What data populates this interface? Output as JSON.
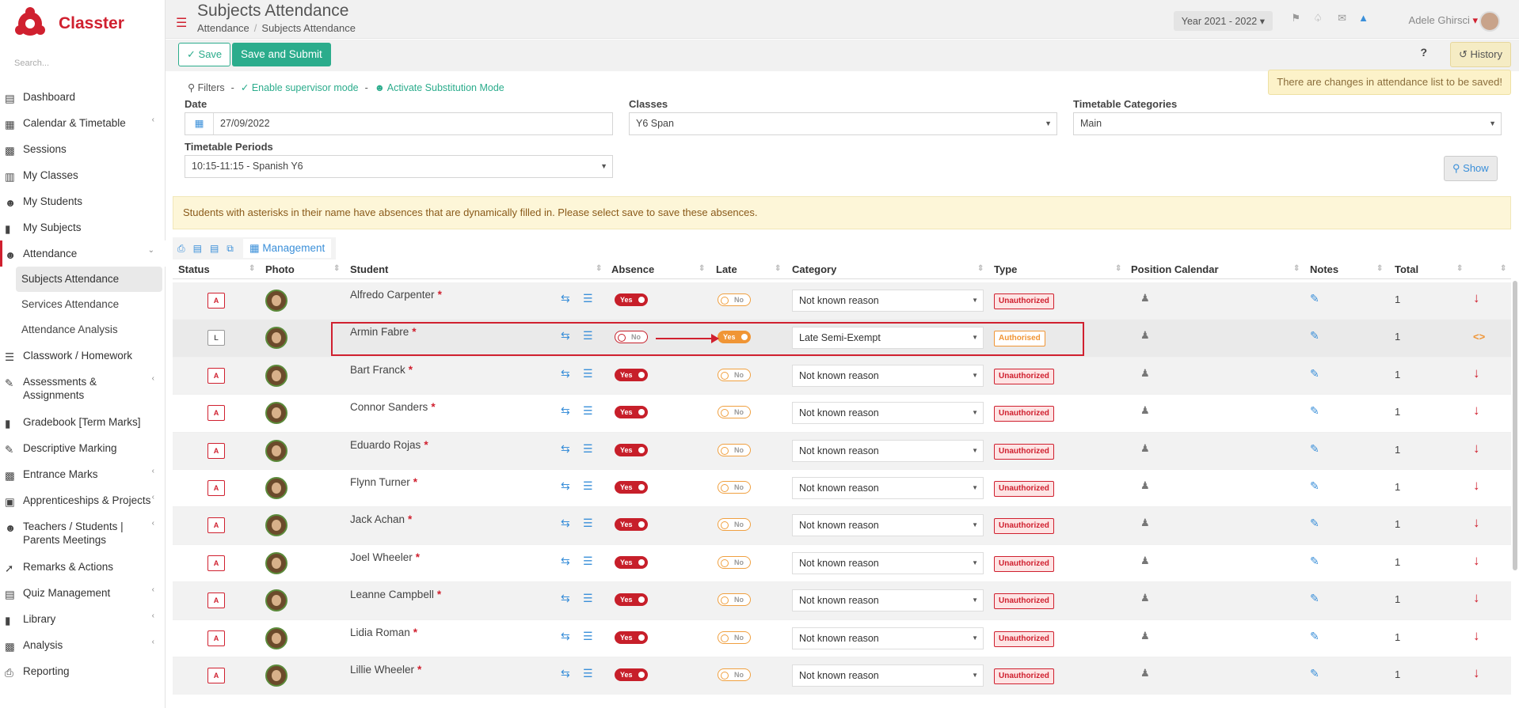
{
  "app": {
    "name": "Classter",
    "search_placeholder": "Search..."
  },
  "sidebar": {
    "items": [
      {
        "label": "Dashboard",
        "icon": "laptop-icon"
      },
      {
        "label": "Calendar & Timetable",
        "icon": "calendar-icon",
        "chevron": true
      },
      {
        "label": "Sessions",
        "icon": "sessions-icon"
      },
      {
        "label": "My Classes",
        "icon": "classes-icon"
      },
      {
        "label": "My Students",
        "icon": "students-icon"
      },
      {
        "label": "My Subjects",
        "icon": "book-icon"
      },
      {
        "label": "Attendance",
        "icon": "attendance-icon",
        "expanded": true
      },
      {
        "label": "Classwork / Homework",
        "icon": "list-icon"
      },
      {
        "label": "Assessments & Assignments",
        "icon": "edit-icon",
        "chevron": true
      },
      {
        "label": "Gradebook [Term Marks]",
        "icon": "gradebook-icon"
      },
      {
        "label": "Descriptive Marking",
        "icon": "marking-icon"
      },
      {
        "label": "Entrance Marks",
        "icon": "entrance-icon",
        "chevron": true
      },
      {
        "label": "Apprenticeships & Projects",
        "icon": "box-icon",
        "chevron": true
      },
      {
        "label": "Teachers / Students | Parents Meetings",
        "icon": "meetings-icon",
        "chevron": true
      },
      {
        "label": "Remarks & Actions",
        "icon": "remarks-icon"
      },
      {
        "label": "Quiz Management",
        "icon": "quiz-icon",
        "chevron": true
      },
      {
        "label": "Library",
        "icon": "library-icon",
        "chevron": true
      },
      {
        "label": "Analysis",
        "icon": "chart-icon",
        "chevron": true
      },
      {
        "label": "Reporting",
        "icon": "printer-icon"
      }
    ],
    "attendance_sub": [
      "Subjects Attendance",
      "Services Attendance",
      "Attendance Analysis"
    ]
  },
  "header": {
    "title": "Subjects Attendance",
    "breadcrumb": [
      "Attendance",
      "Subjects Attendance"
    ],
    "year": "Year 2021 - 2022",
    "user": "Adele Ghirsci"
  },
  "actions": {
    "save": "Save",
    "save_submit": "Save and Submit",
    "help": "?",
    "history": "History",
    "warning": "There are changes in attendance list to be saved!"
  },
  "filters": {
    "label": "Filters",
    "supervisor": "Enable supervisor mode",
    "substitution": "Activate Substitution Mode",
    "date_label": "Date",
    "date_value": "27/09/2022",
    "classes_label": "Classes",
    "classes_value": "Y6 Span",
    "categories_label": "Timetable Categories",
    "categories_value": "Main",
    "periods_label": "Timetable Periods",
    "periods_value": "10:15-11:15 - Spanish Y6",
    "show": "Show"
  },
  "notice": "Students with asterisks in their name have absences that are dynamically filled in. Please select save to save these absences.",
  "toolbar": {
    "management": "Management"
  },
  "table": {
    "headers": [
      "Status",
      "Photo",
      "Student",
      "Absence",
      "Late",
      "Category",
      "Type",
      "Position Calendar",
      "Notes",
      "Total"
    ],
    "rows": [
      {
        "status": "A",
        "name": "Alfredo Carpenter",
        "absence": "Yes",
        "late": "No",
        "category": "Not known reason",
        "type": "Unauthorized",
        "total": "1"
      },
      {
        "status": "L",
        "name": "Armin Fabre",
        "absence": "No",
        "late": "Yes",
        "category": "Late Semi-Exempt",
        "type": "Authorised",
        "total": "1"
      },
      {
        "status": "A",
        "name": "Bart Franck",
        "absence": "Yes",
        "late": "No",
        "category": "Not known reason",
        "type": "Unauthorized",
        "total": "1"
      },
      {
        "status": "A",
        "name": "Connor Sanders",
        "absence": "Yes",
        "late": "No",
        "category": "Not known reason",
        "type": "Unauthorized",
        "total": "1"
      },
      {
        "status": "A",
        "name": "Eduardo Rojas",
        "absence": "Yes",
        "late": "No",
        "category": "Not known reason",
        "type": "Unauthorized",
        "total": "1"
      },
      {
        "status": "A",
        "name": "Flynn Turner",
        "absence": "Yes",
        "late": "No",
        "category": "Not known reason",
        "type": "Unauthorized",
        "total": "1"
      },
      {
        "status": "A",
        "name": "Jack Achan",
        "absence": "Yes",
        "late": "No",
        "category": "Not known reason",
        "type": "Unauthorized",
        "total": "1"
      },
      {
        "status": "A",
        "name": "Joel Wheeler",
        "absence": "Yes",
        "late": "No",
        "category": "Not known reason",
        "type": "Unauthorized",
        "total": "1"
      },
      {
        "status": "A",
        "name": "Leanne Campbell",
        "absence": "Yes",
        "late": "No",
        "category": "Not known reason",
        "type": "Unauthorized",
        "total": "1"
      },
      {
        "status": "A",
        "name": "Lidia Roman",
        "absence": "Yes",
        "late": "No",
        "category": "Not known reason",
        "type": "Unauthorized",
        "total": "1"
      },
      {
        "status": "A",
        "name": "Lillie Wheeler",
        "absence": "Yes",
        "late": "No",
        "category": "Not known reason",
        "type": "Unauthorized",
        "total": "1"
      }
    ]
  }
}
